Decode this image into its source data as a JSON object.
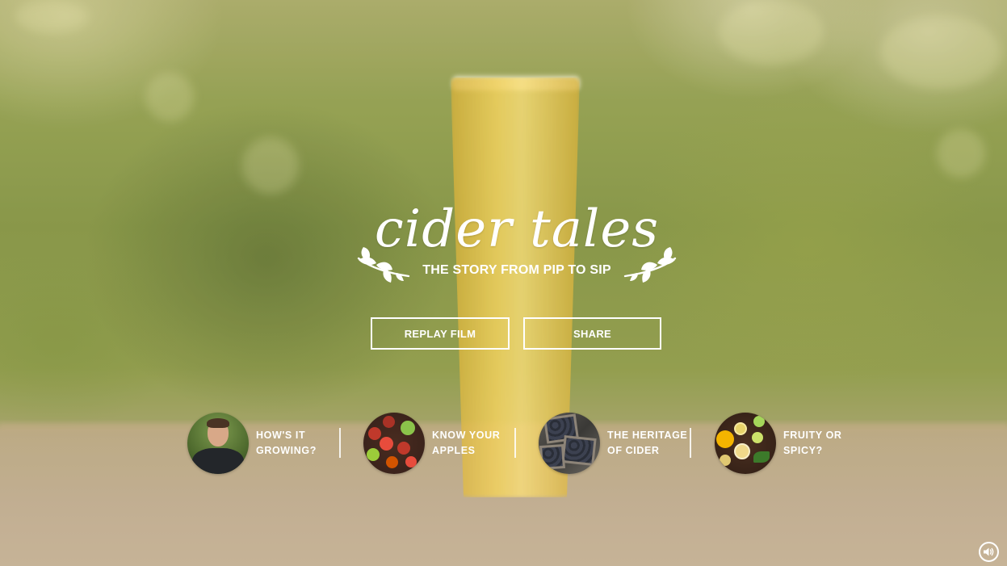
{
  "brand": {
    "script_title": "cider tales",
    "tagline": "THE STORY FROM PIP TO SIP"
  },
  "actions": {
    "replay_label": "REPLAY FILM",
    "share_label": "SHARE"
  },
  "stories": [
    {
      "label": "HOW'S IT\nGROWING?",
      "thumb_icon": "grower-portrait"
    },
    {
      "label": "KNOW YOUR\nAPPLES",
      "thumb_icon": "apples-photo"
    },
    {
      "label": "THE HERITAGE\nOF CIDER",
      "thumb_icon": "crates-photo"
    },
    {
      "label": "FRUITY OR\nSPICY?",
      "thumb_icon": "citrus-photo"
    }
  ],
  "sound": {
    "icon": "speaker-icon",
    "state": "on"
  },
  "colors": {
    "text": "#ffffff",
    "background_green": "#8a9640",
    "table_tan": "#bca888",
    "cider_gold": "#f0cd50"
  }
}
